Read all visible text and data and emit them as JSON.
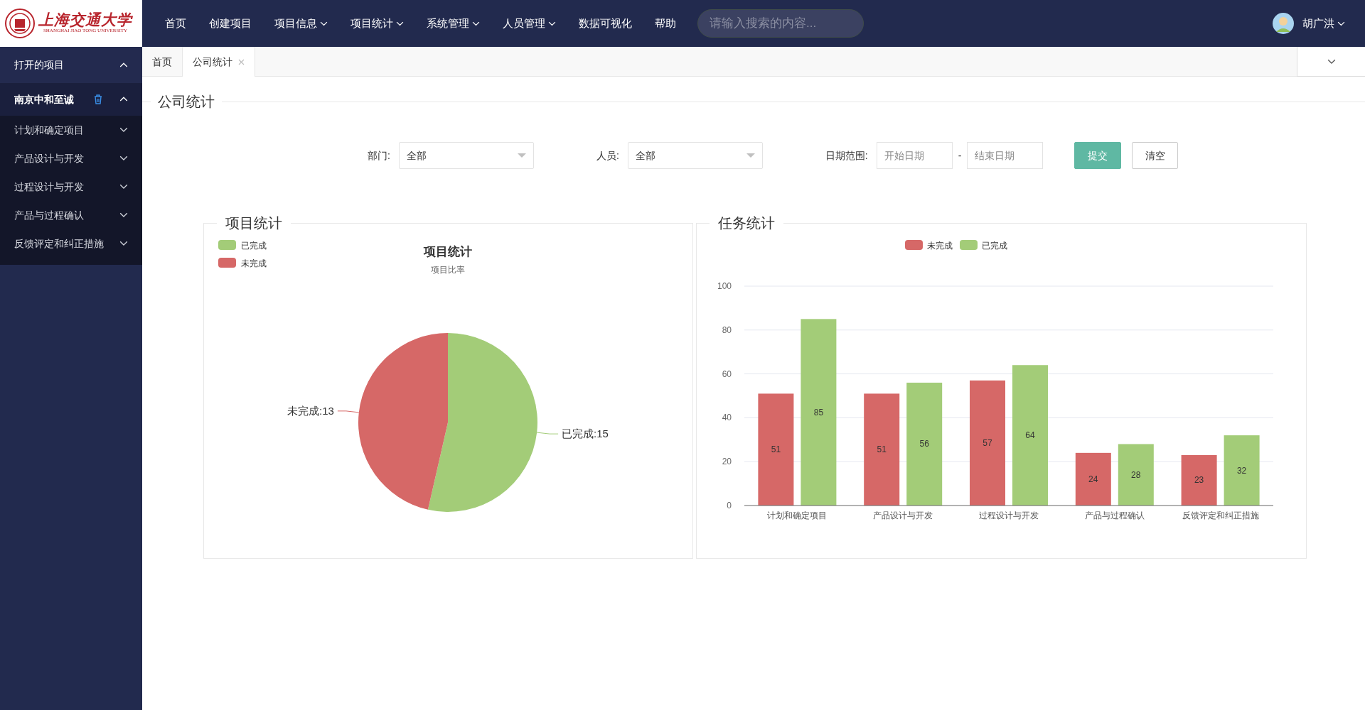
{
  "logo": {
    "name_cn": "上海交通大学",
    "name_en": "SHANGHAI JIAO TONG UNIVERSITY"
  },
  "nav": {
    "items": [
      {
        "label": "首页",
        "has_menu": false
      },
      {
        "label": "创建项目",
        "has_menu": false
      },
      {
        "label": "项目信息",
        "has_menu": true
      },
      {
        "label": "项目统计",
        "has_menu": true
      },
      {
        "label": "系统管理",
        "has_menu": true
      },
      {
        "label": "人员管理",
        "has_menu": true
      },
      {
        "label": "数据可视化",
        "has_menu": false
      },
      {
        "label": "帮助",
        "has_menu": false
      }
    ],
    "search": {
      "placeholder": "请输入搜索的内容..."
    },
    "user": {
      "name": "胡广洪"
    }
  },
  "sidebar": {
    "sections": [
      {
        "label": "打开的项目",
        "expanded": true,
        "children": [
          {
            "label": "南京中和至诚",
            "expanded": true,
            "children": [
              {
                "label": "计划和确定项目",
                "expanded": false
              },
              {
                "label": "产品设计与开发",
                "expanded": false
              },
              {
                "label": "过程设计与开发",
                "expanded": false
              },
              {
                "label": "产品与过程确认",
                "expanded": false
              },
              {
                "label": "反馈评定和纠正措施",
                "expanded": false
              }
            ]
          }
        ]
      }
    ]
  },
  "tabs": [
    {
      "label": "首页",
      "selected": false,
      "closable": false
    },
    {
      "label": "公司统计",
      "selected": true,
      "closable": true
    }
  ],
  "page_title": "公司统计",
  "filters": [
    {
      "kind": "select",
      "label": "部门:",
      "value": "全部"
    },
    {
      "kind": "select",
      "label": "人员:",
      "value": "全部"
    },
    {
      "kind": "daterange",
      "label": "日期范围:",
      "start_placeholder": "开始日期",
      "separator": "-",
      "end_placeholder": "结束日期"
    }
  ],
  "buttons": [
    {
      "label": "提交",
      "kind": "primary"
    },
    {
      "label": "清空",
      "kind": "secondary"
    }
  ],
  "panels": [
    {
      "title": "项目统计",
      "subtitle": "项目比率",
      "chart_data": {
        "type": "pie",
        "title": "项目统计",
        "categories": [
          "已完成",
          "未完成"
        ],
        "values": [
          15,
          13
        ],
        "colors": [
          "#a3cc78",
          "#d66867"
        ],
        "value_labels": [
          "已完成:15",
          "未完成:13"
        ],
        "legend": true
      }
    },
    {
      "title": "任务统计",
      "chart_data": {
        "type": "bar",
        "categories": [
          "计划和确定项目",
          "产品设计与开发",
          "过程设计与开发",
          "产品与过程确认",
          "反馈评定和纠正措施"
        ],
        "series": [
          {
            "name": "未完成",
            "color": "#d66867",
            "values": [
              51,
              51,
              57,
              24,
              23
            ]
          },
          {
            "name": "已完成",
            "color": "#a3cc78",
            "values": [
              85,
              56,
              64,
              28,
              32
            ]
          }
        ],
        "ylim": [
          0,
          100
        ],
        "yticks": [
          0,
          20,
          40,
          60,
          80,
          100
        ],
        "data_labels": true,
        "grid": true,
        "legend": true
      }
    }
  ]
}
